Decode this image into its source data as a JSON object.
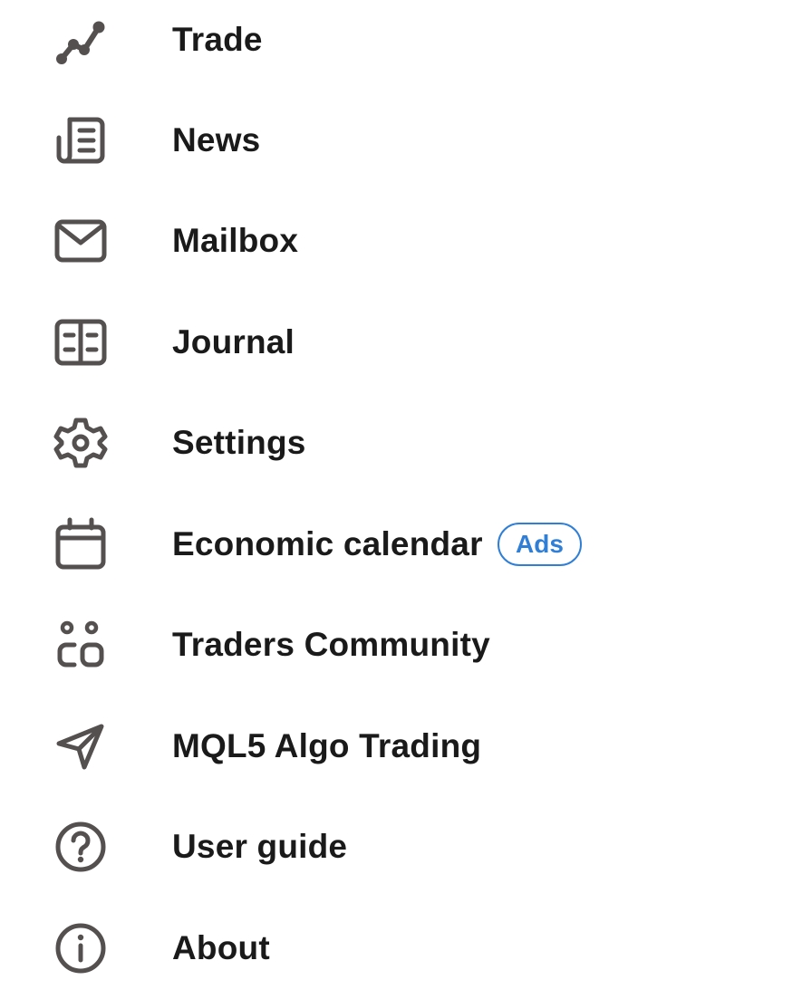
{
  "menu": {
    "items": [
      {
        "label": "Trade",
        "icon": "trade-chart-icon"
      },
      {
        "label": "News",
        "icon": "news-icon"
      },
      {
        "label": "Mailbox",
        "icon": "mail-icon"
      },
      {
        "label": "Journal",
        "icon": "journal-icon"
      },
      {
        "label": "Settings",
        "icon": "gear-icon"
      },
      {
        "label": "Economic calendar",
        "icon": "calendar-icon",
        "badge": "Ads"
      },
      {
        "label": "Traders Community",
        "icon": "community-icon"
      },
      {
        "label": "MQL5 Algo Trading",
        "icon": "send-icon"
      },
      {
        "label": "User guide",
        "icon": "help-icon"
      },
      {
        "label": "About",
        "icon": "info-icon"
      }
    ]
  },
  "colors": {
    "icon": "#555050",
    "text": "#1a1a1a",
    "badge": "#2f7fd6",
    "background": "#ffffff"
  }
}
